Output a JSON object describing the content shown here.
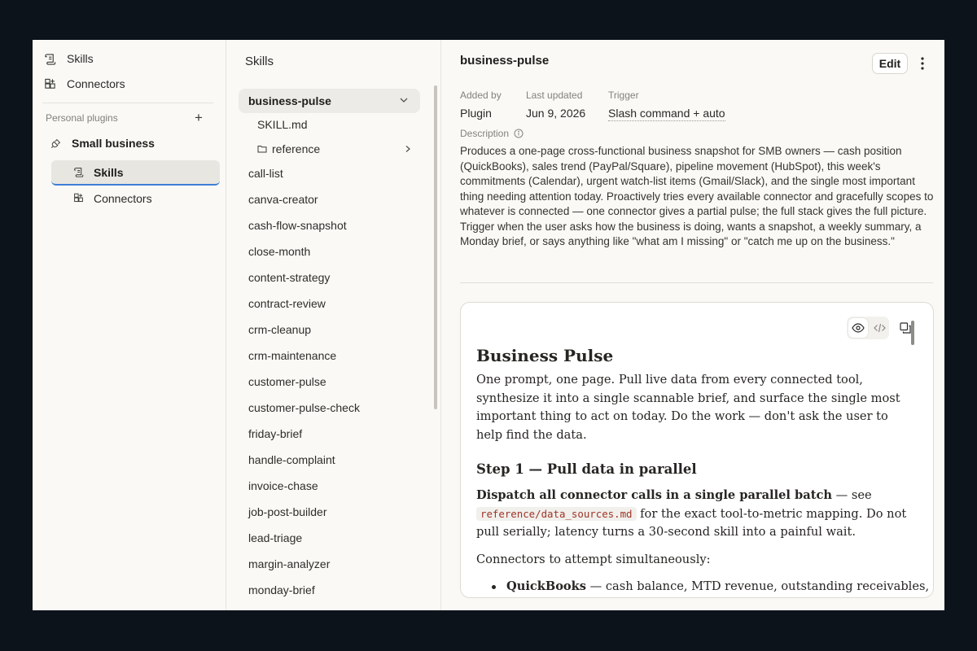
{
  "sidebar": {
    "nav": [
      {
        "label": "Skills",
        "icon": "scroll-icon"
      },
      {
        "label": "Connectors",
        "icon": "grid-plus-icon"
      }
    ],
    "section_label": "Personal plugins",
    "add_icon": "plus-icon",
    "plugin": {
      "label": "Small business",
      "icon": "plug-icon"
    },
    "plugin_items": [
      {
        "label": "Skills",
        "icon": "scroll-icon",
        "active": true
      },
      {
        "label": "Connectors",
        "icon": "grid-plus-icon",
        "active": false
      }
    ]
  },
  "skills_list": {
    "title": "Skills",
    "selected": {
      "label": "business-pulse",
      "files": [
        {
          "label": "SKILL.md"
        },
        {
          "label": "reference",
          "icon": "folder-icon"
        }
      ]
    },
    "items": [
      "call-list",
      "canva-creator",
      "cash-flow-snapshot",
      "close-month",
      "content-strategy",
      "contract-review",
      "crm-cleanup",
      "crm-maintenance",
      "customer-pulse",
      "customer-pulse-check",
      "friday-brief",
      "handle-complaint",
      "invoice-chase",
      "job-post-builder",
      "lead-triage",
      "margin-analyzer",
      "monday-brief"
    ]
  },
  "detail": {
    "title": "business-pulse",
    "edit_label": "Edit",
    "meta": [
      {
        "label": "Added by",
        "value": "Plugin"
      },
      {
        "label": "Last updated",
        "value": "Jun 9, 2026"
      },
      {
        "label": "Trigger",
        "value": "Slash command + auto"
      }
    ],
    "description_label": "Description",
    "description": "Produces a one-page cross-functional business snapshot for SMB owners — cash position (QuickBooks), sales trend (PayPal/Square), pipeline movement (HubSpot), this week's commitments (Calendar), urgent watch-list items (Gmail/Slack), and the single most important thing needing attention today. Proactively tries every available connector and gracefully scopes to whatever is connected — one connector gives a partial pulse; the full stack gives the full picture. Trigger when the user asks how the business is doing, wants a snapshot, a weekly summary, a Monday brief, or says anything like \"what am I missing\" or \"catch me up on the business.\"",
    "doc": {
      "h1": "Business Pulse",
      "intro": "One prompt, one page. Pull live data from every connected tool, synthesize it into a single scannable brief, and surface the single most important thing to act on today. Do the work — don't ask the user to help find the data.",
      "h2": "Step 1 — Pull data in parallel",
      "p2_bold": "Dispatch all connector calls in a single parallel batch",
      "p2_a": " — see ",
      "p2_code": "reference/data_sources.md",
      "p2_b": " for the exact tool-to-metric mapping. Do not pull serially; latency turns a 30-second skill into a painful wait.",
      "p3": "Connectors to attempt simultaneously:",
      "bullet_bold": "QuickBooks",
      "bullet_text": " — cash balance, MTD revenue, outstanding receivables,"
    }
  }
}
